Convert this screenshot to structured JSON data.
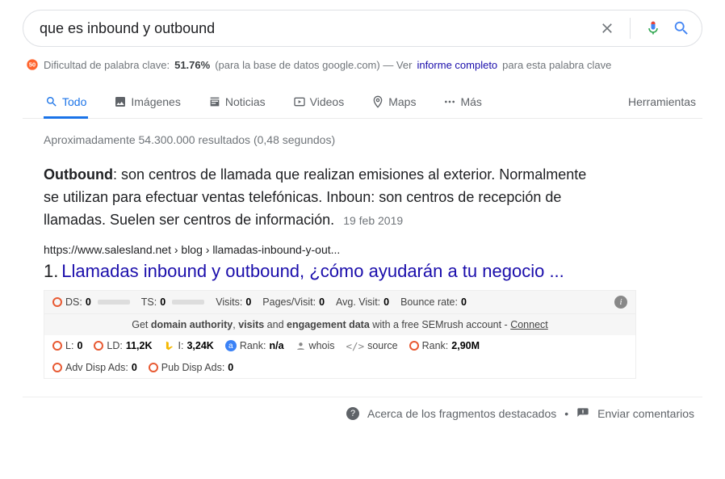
{
  "search": {
    "query": "que es inbound y outbound",
    "placeholder": ""
  },
  "keyword": {
    "prefix": "Dificultad de palabra clave:",
    "percent": "51.76%",
    "mid": "(para la base de datos google.com) — Ver",
    "link": "informe completo",
    "suffix": "para esta palabra clave"
  },
  "tabs": {
    "all": "Todo",
    "images": "Imágenes",
    "news": "Noticias",
    "videos": "Videos",
    "maps": "Maps",
    "more": "Más",
    "tools": "Herramientas"
  },
  "stats": "Aproximadamente 54.300.000 resultados (0,48 segundos)",
  "snippet": {
    "bold": "Outbound",
    "body": ": son centros de llamada que realizan emisiones al exterior. Normalmente se utilizan para efectuar ventas telefónicas. Inboun: son centros de recepción de llamadas. Suelen ser centros de información.",
    "date": "19 feb 2019"
  },
  "result": {
    "url": "https://www.salesland.net › blog › llamadas-inbound-y-out...",
    "rank": "1.",
    "title": "Llamadas inbound y outbound, ¿cómo ayudarán a tu negocio ..."
  },
  "seo": {
    "row1": {
      "ds": "DS:",
      "dsv": "0",
      "ts": "TS:",
      "tsv": "0",
      "visits": "Visits:",
      "visitsv": "0",
      "pages": "Pages/Visit:",
      "pagesv": "0",
      "avg": "Avg. Visit:",
      "avgv": "0",
      "bounce": "Bounce rate:",
      "bouncev": "0"
    },
    "promo": {
      "p1": "Get ",
      "b1": "domain authority",
      "p2": ", ",
      "b2": "visits",
      "p3": " and ",
      "b3": "engagement data",
      "p4": " with a free SEMrush account - ",
      "link": "Connect"
    },
    "row2": {
      "l": "L:",
      "lv": "0",
      "ld": "LD:",
      "ldv": "11,2K",
      "i": "I:",
      "iv": "3,24K",
      "rank": "Rank:",
      "rankv": "n/a",
      "whois": "whois",
      "source": "source",
      "rank2": "Rank:",
      "rank2v": "2,90M"
    },
    "row3": {
      "adv": "Adv Disp Ads:",
      "advv": "0",
      "pub": "Pub Disp Ads:",
      "pubv": "0"
    }
  },
  "footer": {
    "about": "Acerca de los fragmentos destacados",
    "feedback": "Enviar comentarios"
  }
}
